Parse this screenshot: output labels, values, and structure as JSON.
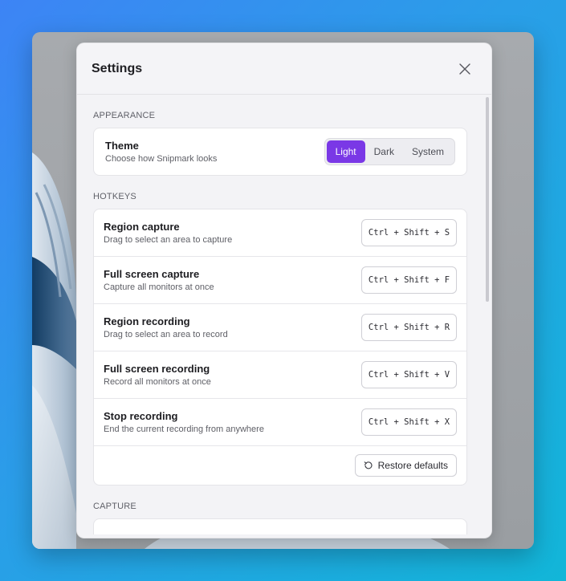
{
  "dialog": {
    "title": "Settings"
  },
  "appearance": {
    "section_label": "APPEARANCE",
    "theme": {
      "title": "Theme",
      "description": "Choose how Snipmark looks",
      "options": [
        "Light",
        "Dark",
        "System"
      ],
      "selected": "Light"
    }
  },
  "hotkeys": {
    "section_label": "HOTKEYS",
    "items": [
      {
        "title": "Region capture",
        "description": "Drag to select an area to capture",
        "shortcut": "Ctrl + Shift + S"
      },
      {
        "title": "Full screen capture",
        "description": "Capture all monitors at once",
        "shortcut": "Ctrl + Shift + F"
      },
      {
        "title": "Region recording",
        "description": "Drag to select an area to record",
        "shortcut": "Ctrl + Shift + R"
      },
      {
        "title": "Full screen recording",
        "description": "Record all monitors at once",
        "shortcut": "Ctrl + Shift + V"
      },
      {
        "title": "Stop recording",
        "description": "End the current recording from anywhere",
        "shortcut": "Ctrl + Shift + X"
      }
    ],
    "restore_label": "Restore defaults"
  },
  "capture": {
    "section_label": "CAPTURE"
  },
  "colors": {
    "accent": "#7a38e6"
  },
  "icons": {
    "close": "close-icon",
    "restore": "restore-icon"
  }
}
